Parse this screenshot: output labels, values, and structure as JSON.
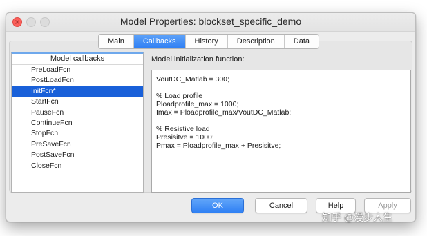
{
  "window": {
    "title": "Model Properties: blockset_specific_demo",
    "colors": {
      "close": "#fc605b",
      "accent": "#2f80f4",
      "selection": "#1960d9"
    }
  },
  "tabs": [
    {
      "label": "Main",
      "active": false
    },
    {
      "label": "Callbacks",
      "active": true
    },
    {
      "label": "History",
      "active": false
    },
    {
      "label": "Description",
      "active": false
    },
    {
      "label": "Data",
      "active": false
    }
  ],
  "callbacks": {
    "header": "Model callbacks",
    "items": [
      "PreLoadFcn",
      "PostLoadFcn",
      "InitFcn*",
      "StartFcn",
      "PauseFcn",
      "ContinueFcn",
      "StopFcn",
      "PreSaveFcn",
      "PostSaveFcn",
      "CloseFcn"
    ],
    "selected": "InitFcn*"
  },
  "editor": {
    "label": "Model initialization function:",
    "lines": [
      "VoutDC_Matlab = 300;",
      "",
      "% Load profile",
      "Ploadprofile_max = 1000;",
      "Imax = Ploadprofile_max/VoutDC_Matlab;",
      "",
      "% Resistive load",
      "Presisitve = 1000;",
      "Pmax = Ploadprofile_max + Presisitve;"
    ]
  },
  "buttons": {
    "ok": "OK",
    "cancel": "Cancel",
    "help": "Help",
    "apply": "Apply"
  },
  "watermark": "知乎 @漫步人生"
}
